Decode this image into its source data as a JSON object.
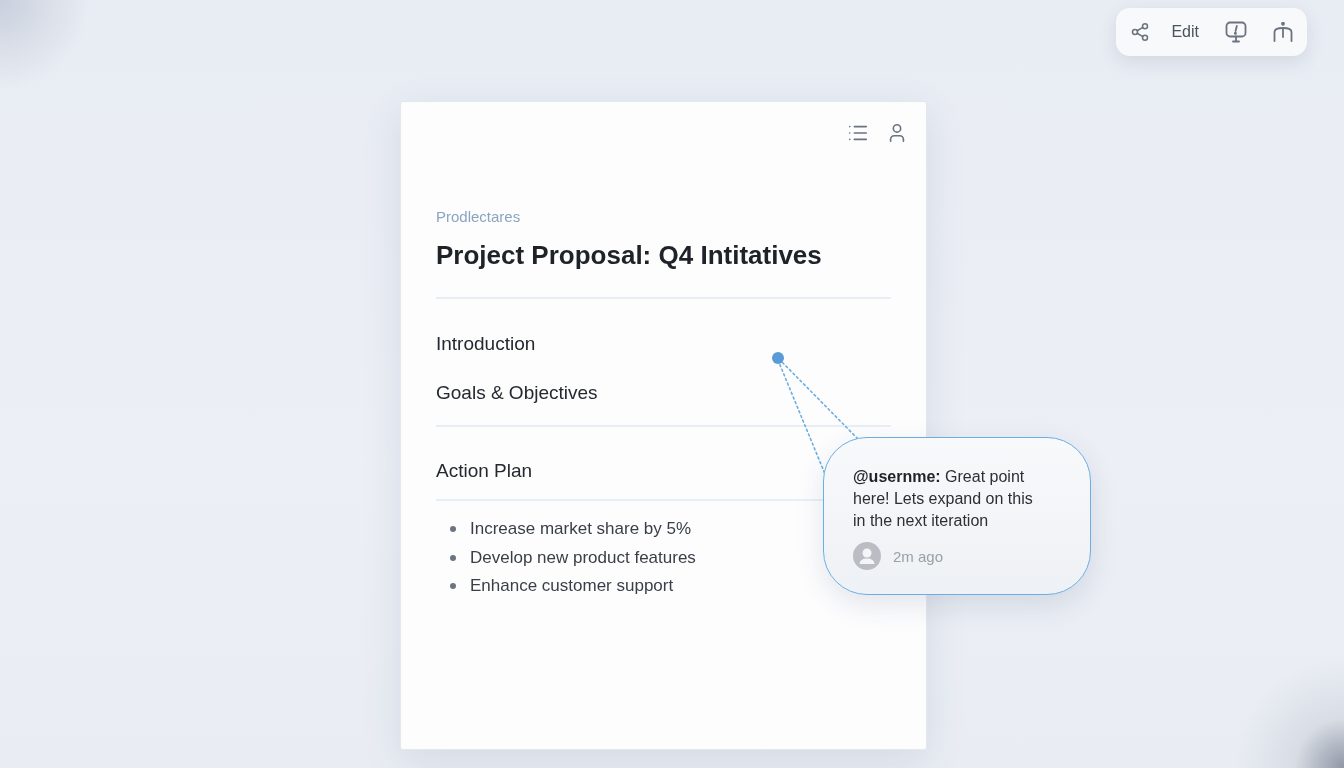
{
  "toolbar": {
    "edit_button": "Edit"
  },
  "document": {
    "eyebrow": "Prodlectares",
    "title": "Project Proposal: Q4 Intitatives",
    "sections": [
      {
        "heading": "Introduction"
      },
      {
        "heading": "Goals & Objectives"
      },
      {
        "heading": "Action Plan",
        "items": [
          "Increase market share by 5%",
          "Develop new product features",
          "Enhance customer support"
        ]
      }
    ]
  },
  "comment": {
    "text": "**@usernme:** Great point here! Lets expand on this in the next iteration",
    "time": "2m ago"
  }
}
